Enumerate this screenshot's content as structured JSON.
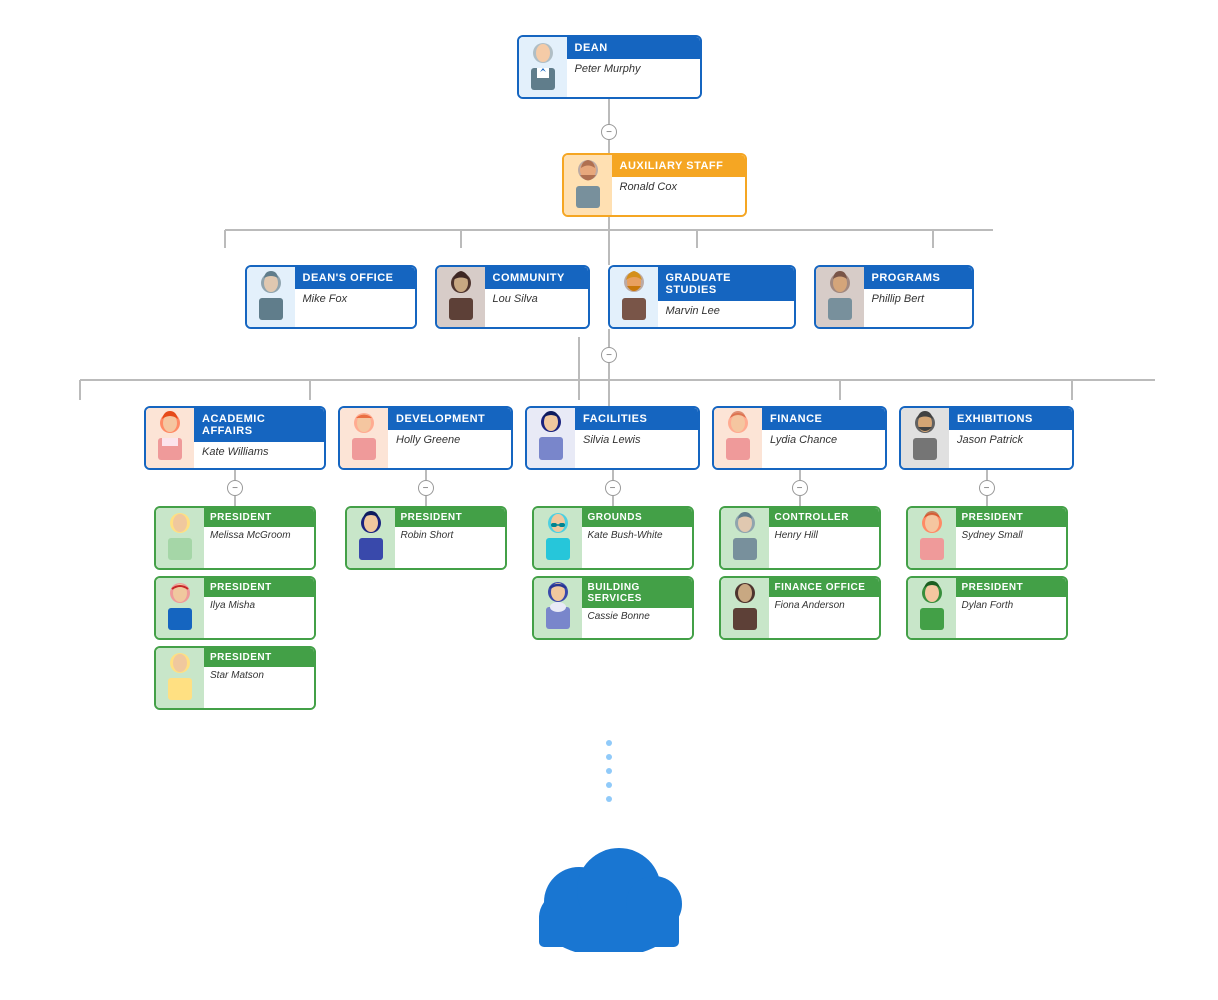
{
  "dean": {
    "title": "DEAN",
    "name": "Peter Murphy"
  },
  "aux": {
    "title": "AUXILIARY STAFF",
    "name": "Ronald Cox"
  },
  "mid": [
    {
      "title": "DEAN'S OFFICE",
      "name": "Mike Fox"
    },
    {
      "title": "COMMUNITY",
      "name": "Lou Silva"
    },
    {
      "title": "GRADUATE STUDIES",
      "name": "Marvin Lee"
    },
    {
      "title": "PROGRAMS",
      "name": "Phillip Bert"
    }
  ],
  "departments": [
    {
      "title": "ACADEMIC AFFAIRS",
      "name": "Kate Williams",
      "subs": [
        {
          "title": "PRESIDENT",
          "name": "Melissa McGroom"
        },
        {
          "title": "PRESIDENT",
          "name": "Ilya Misha"
        },
        {
          "title": "PRESIDENT",
          "name": "Star Matson"
        }
      ]
    },
    {
      "title": "DEVELOPMENT",
      "name": "Holly Greene",
      "subs": [
        {
          "title": "PRESIDENT",
          "name": "Robin Short"
        }
      ]
    },
    {
      "title": "FACILITIES",
      "name": "Silvia Lewis",
      "subs": [
        {
          "title": "GROUNDS",
          "name": "Kate Bush-White"
        },
        {
          "title": "BUILDING SERVICES",
          "name": "Cassie Bonne"
        }
      ]
    },
    {
      "title": "FINANCE",
      "name": "Lydia Chance",
      "subs": [
        {
          "title": "CONTROLLER",
          "name": "Henry Hill"
        },
        {
          "title": "FINANCE OFFICE",
          "name": "Fiona Anderson"
        }
      ]
    },
    {
      "title": "EXHIBITIONS",
      "name": "Jason Patrick",
      "subs": [
        {
          "title": "PRESIDENT",
          "name": "Sydney Small"
        },
        {
          "title": "PRESIDENT",
          "name": "Dylan Forth"
        }
      ]
    }
  ],
  "minus_symbol": "−",
  "dots_count": 5
}
